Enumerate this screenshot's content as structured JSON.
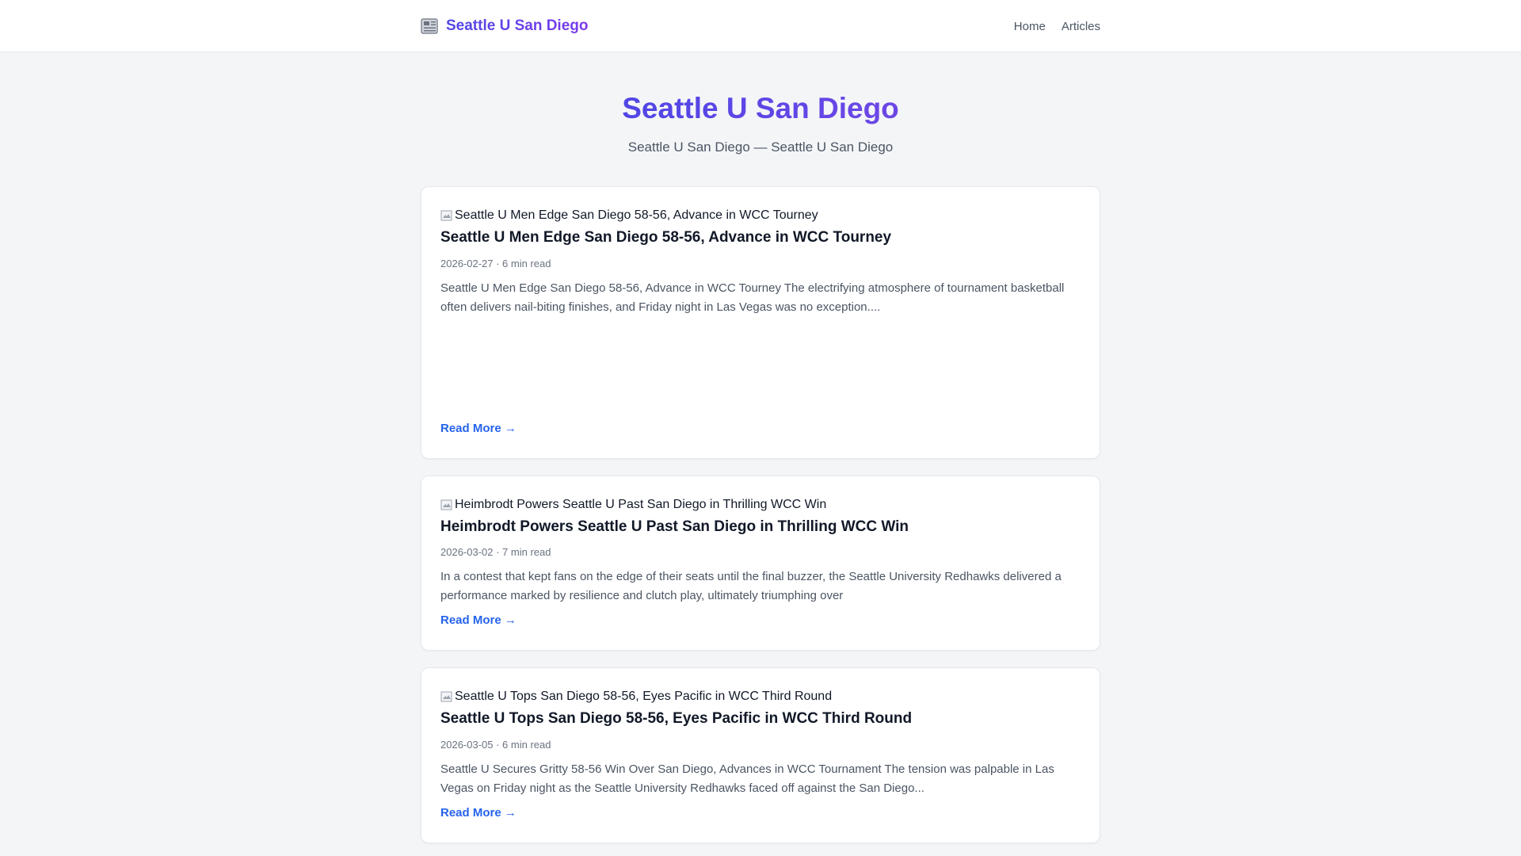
{
  "header": {
    "brand_icon": "newspaper-icon",
    "brand": "Seattle U San Diego",
    "nav": [
      "Home",
      "Articles"
    ]
  },
  "hero": {
    "title": "Seattle U San Diego",
    "subtitle": "Seattle U San Diego — Seattle U San Diego"
  },
  "articles": [
    {
      "image_alt": "Seattle U Men Edge San Diego 58-56, Advance in WCC Tourney",
      "title": "Seattle U Men Edge San Diego 58-56, Advance in WCC Tourney",
      "meta": "2026-02-27 · 6 min read",
      "excerpt": "Seattle U Men Edge San Diego 58-56, Advance in WCC Tourney The electrifying atmosphere of tournament basketball often delivers nail-biting finishes, and Friday night in Las Vegas was no exception....",
      "read_more": "Read More →"
    },
    {
      "image_alt": "Heimbrodt Powers Seattle U Past San Diego in Thrilling WCC Win",
      "title": "Heimbrodt Powers Seattle U Past San Diego in Thrilling WCC Win",
      "meta": "2026-03-02 · 7 min read",
      "excerpt": "In a contest that kept fans on the edge of their seats until the final buzzer, the Seattle University Redhawks delivered a performance marked by resilience and clutch play, ultimately triumphing over",
      "read_more": "Read More →"
    },
    {
      "image_alt": "Seattle U Tops San Diego 58-56, Eyes Pacific in WCC Third Round",
      "title": "Seattle U Tops San Diego 58-56, Eyes Pacific in WCC Third Round",
      "meta": "2026-03-05 · 6 min read",
      "excerpt": "Seattle U Secures Gritty 58-56 Win Over San Diego, Advances in WCC Tournament The tension was palpable in Las Vegas on Friday night as the Seattle University Redhawks faced off against the San Diego...",
      "read_more": "Read More →"
    }
  ],
  "colors": {
    "accent": "#4f46e5",
    "link": "#2563eb",
    "background": "#f4f5f7"
  }
}
